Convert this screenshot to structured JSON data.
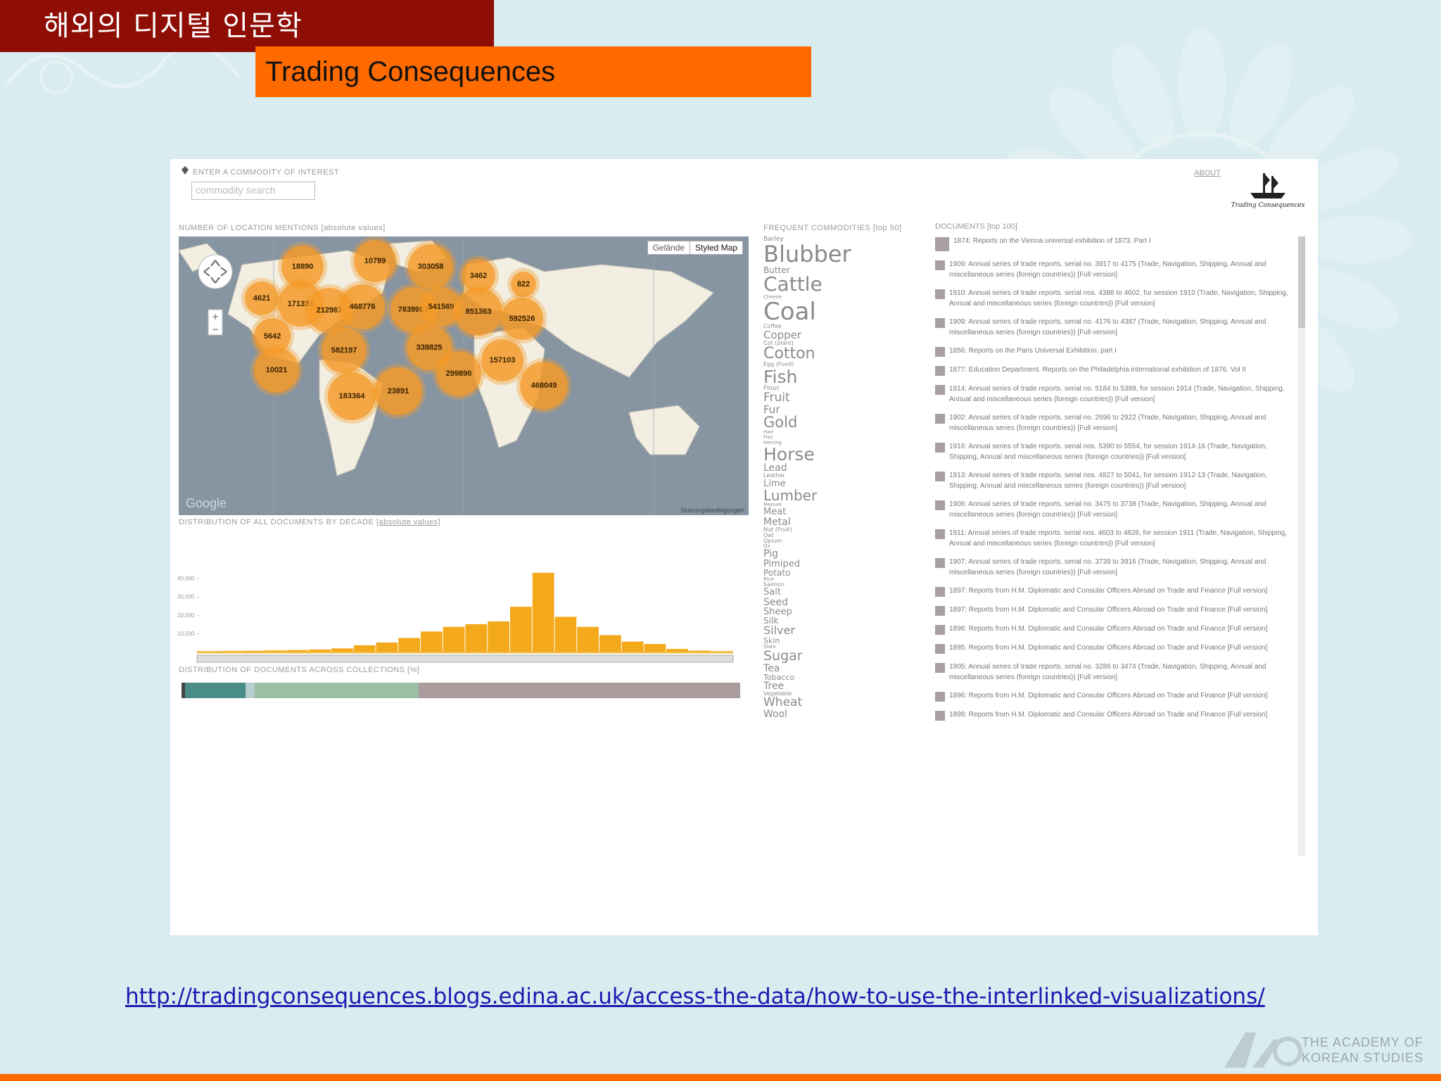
{
  "slide": {
    "header_title": "해외의 디지털 인문학",
    "subtitle": "Trading Consequences",
    "url": "http://tradingconsequences.blogs.edina.ac.uk/access-the-data/how-to-use-the-interlinked-visualizations/",
    "org_line1": "THE ACADEMY OF",
    "org_line2": "KOREAN STUDIES",
    "colors": {
      "header": "#8e0e05",
      "subtitle": "#ff6a00",
      "background": "#d9ecef",
      "link": "#1a1ab0"
    }
  },
  "app": {
    "search_label": "ENTER A COMMODITY OF INTEREST",
    "search_placeholder": "commodity search",
    "about_label": "ABOUT",
    "logo_text": "Trading Consequences",
    "map_title": "NUMBER OF LOCATION MENTIONS [absolute values]",
    "map_btn_terrain": "Gelände",
    "map_btn_styled": "Styled Map",
    "map_brand": "Google",
    "map_terms": "Nutzungsbedingungen",
    "hist_title": "DISTRIBUTION OF ALL DOCUMENTS BY DECADE",
    "hist_title_link": "[absolute values]",
    "coll_title": "DISTRIBUTION OF DOCUMENTS ACROSS COLLECTIONS [%]",
    "commodities_title": "FREQUENT COMMODITIES [top 50]",
    "documents_title": "DOCUMENTS [top 100]"
  },
  "clusters": [
    {
      "label": "18890"
    },
    {
      "label": "10789"
    },
    {
      "label": "303058"
    },
    {
      "label": "3462"
    },
    {
      "label": "822"
    },
    {
      "label": "4621"
    },
    {
      "label": "171333"
    },
    {
      "label": "212987"
    },
    {
      "label": "468776"
    },
    {
      "label": "7839963"
    },
    {
      "label": "541569"
    },
    {
      "label": "851363"
    },
    {
      "label": "592526"
    },
    {
      "label": "5642"
    },
    {
      "label": "582197"
    },
    {
      "label": "338825"
    },
    {
      "label": "157103"
    },
    {
      "label": "10021"
    },
    {
      "label": "299890"
    },
    {
      "label": "183364"
    },
    {
      "label": "23891"
    },
    {
      "label": "468049"
    }
  ],
  "chart_data": {
    "type": "bar",
    "title": "DISTRIBUTION OF ALL DOCUMENTS BY DECADE",
    "yticks": [
      "40,000 –",
      "30,000 –",
      "20,000 –",
      "10,000 –"
    ],
    "ylim": [
      0,
      46000
    ],
    "values": [
      300,
      400,
      500,
      700,
      900,
      1200,
      1800,
      3500,
      5000,
      7500,
      11000,
      13500,
      15000,
      16500,
      24500,
      43000,
      19000,
      13500,
      9000,
      5500,
      4200,
      1500,
      600,
      300
    ]
  },
  "collections": [
    {
      "color": "#444444",
      "share": 0.6
    },
    {
      "color": "#4a8c88",
      "share": 11
    },
    {
      "color": "#b7cccc",
      "share": 1.6
    },
    {
      "color": "#99bfa5",
      "share": 29.5
    },
    {
      "color": "#aa9c9c",
      "share": 58
    }
  ],
  "commodities": [
    {
      "name": "Barley",
      "size": 9
    },
    {
      "name": "Blubber",
      "size": 32
    },
    {
      "name": "Butter",
      "size": 12
    },
    {
      "name": "Cattle",
      "size": 28
    },
    {
      "name": "Cheese",
      "size": 7
    },
    {
      "name": "Coal",
      "size": 34
    },
    {
      "name": "Coffee",
      "size": 8
    },
    {
      "name": "Copper",
      "size": 15
    },
    {
      "name": "Cot (plant)",
      "size": 8
    },
    {
      "name": "Cotton",
      "size": 22
    },
    {
      "name": "Egg (Food)",
      "size": 8
    },
    {
      "name": "Fish",
      "size": 25
    },
    {
      "name": "Flour",
      "size": 9
    },
    {
      "name": "Fruit",
      "size": 17
    },
    {
      "name": "Fur",
      "size": 15
    },
    {
      "name": "Gold",
      "size": 21
    },
    {
      "name": "Hair",
      "size": 7
    },
    {
      "name": "Hay",
      "size": 7
    },
    {
      "name": "Herring",
      "size": 7
    },
    {
      "name": "Horse",
      "size": 25
    },
    {
      "name": "Lead",
      "size": 14
    },
    {
      "name": "Leather",
      "size": 8
    },
    {
      "name": "Lime",
      "size": 13
    },
    {
      "name": "Lumber",
      "size": 20
    },
    {
      "name": "Manure",
      "size": 7
    },
    {
      "name": "Meat",
      "size": 13
    },
    {
      "name": "Metal",
      "size": 14
    },
    {
      "name": "Nut (Fruit)",
      "size": 8
    },
    {
      "name": "Oat",
      "size": 8
    },
    {
      "name": "Opium",
      "size": 8
    },
    {
      "name": "Ox",
      "size": 7
    },
    {
      "name": "Pig",
      "size": 14
    },
    {
      "name": "Pimiped",
      "size": 13
    },
    {
      "name": "Potato",
      "size": 12
    },
    {
      "name": "Rice",
      "size": 7
    },
    {
      "name": "Salmon",
      "size": 8
    },
    {
      "name": "Salt",
      "size": 13
    },
    {
      "name": "Seed",
      "size": 14
    },
    {
      "name": "Sheep",
      "size": 13
    },
    {
      "name": "Silk",
      "size": 12
    },
    {
      "name": "Silver",
      "size": 16
    },
    {
      "name": "Skin",
      "size": 11
    },
    {
      "name": "Slate",
      "size": 7
    },
    {
      "name": "Sugar",
      "size": 19
    },
    {
      "name": "Tea",
      "size": 14
    },
    {
      "name": "Tobacco",
      "size": 11
    },
    {
      "name": "Tree",
      "size": 14
    },
    {
      "name": "Vegetable",
      "size": 8
    },
    {
      "name": "Wheat",
      "size": 17
    },
    {
      "name": "Wool",
      "size": 14
    }
  ],
  "documents": [
    "1874: Reports on the Vienna universal exhibition of 1873. Part I",
    "1909: Annual series of trade reports. serial no. 3917 to 4175 (Trade, Navigation, Shipping, Annual and miscellaneous series (foreign countries)) [Full version]",
    "1910: Annual series of trade reports. serial nos. 4388 to 4602, for session 1910 (Trade, Navigation, Shipping, Annual and miscellaneous series (foreign countries)) [Full version]",
    "1909: Annual series of trade reports. serial no. 4176 to 4387 (Trade, Navigation, Shipping, Annual and miscellaneous series (foreign countries)) [Full version]",
    "1856: Reports on the Paris Universal Exhibition. part I",
    "1877: Education Department. Reports on the Philadelphia international exhibition of 1876. Vol II",
    "1914: Annual series of trade reports. serial no. 5184 to 5389, for session 1914 (Trade, Navigation, Shipping, Annual and miscellaneous series (foreign countries)) [Full version]",
    "1902: Annual series of trade reports. serial no. 2696 to 2922 (Trade, Navigation, Shipping, Annual and miscellaneous series (foreign countries)) [Full version]",
    "1916: Annual series of trade reports. serial nos. 5390 to 5554, for session 1914-16 (Trade, Navigation, Shipping, Annual and miscellaneous series (foreign countries)) [Full version]",
    "1913: Annual series of trade reports. serial nos. 4827 to 5041, for session 1912-13 (Trade, Navigation, Shipping, Annual and miscellaneous series (foreign countries)) [Full version]",
    "1906: Annual series of trade reports. serial no. 3475 to 3738 (Trade, Navigation, Shipping, Annual and miscellaneous series (foreign countries)) [Full version]",
    "1911: Annual series of trade reports. serial nos. 4603 to 4826, for session 1911 (Trade, Navigation, Shipping, Annual and miscellaneous series (foreign countries)) [Full version]",
    "1907: Annual series of trade reports. serial no. 3739 to 3916 (Trade, Navigation, Shipping, Annual and miscellaneous series (foreign countries)) [Full version]",
    "1897: Reports from H.M. Diplomatic and Consular Officers Abroad on Trade and Finance [Full version]",
    "1897: Reports from H.M. Diplomatic and Consular Officers Abroad on Trade and Finance [Full version]",
    "1896: Reports from H.M. Diplomatic and Consular Officers Abroad on Trade and Finance [Full version]",
    "1895: Reports from H.M. Diplomatic and Consular Officers Abroad on Trade and Finance [Full version]",
    "1905: Annual series of trade reports. serial no. 3286 to 3474 (Trade, Navigation, Shipping, Annual and miscellaneous series (foreign countries)) [Full version]",
    "1896: Reports from H.M. Diplomatic and Consular Officers Abroad on Trade and Finance [Full version]",
    "1898: Reports from H.M. Diplomatic and Consular Officers Abroad on Trade and Finance [Full version]"
  ]
}
